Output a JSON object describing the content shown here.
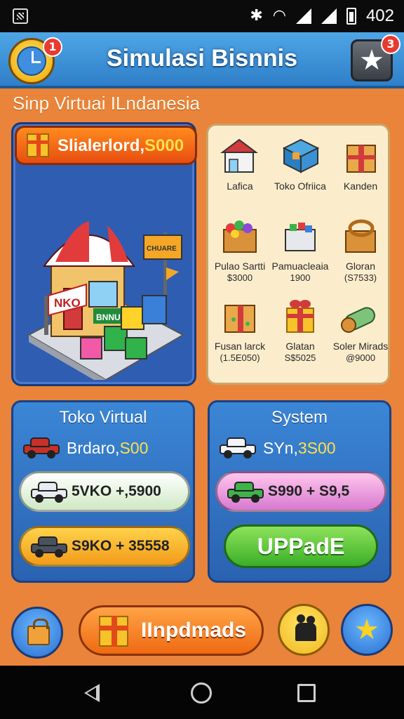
{
  "status_bar": {
    "time": "402"
  },
  "header": {
    "title": "Simulasi Bisnnis",
    "clock_badge": "1",
    "star_badge": "3"
  },
  "subtitle": "Sinp Virtuai ILndanesia",
  "reward": {
    "label": "Slialerlord,",
    "amount": "S000"
  },
  "shop_sign": {
    "left": "NKO",
    "right": "CHUARE",
    "store": "BNNUS"
  },
  "catalog": {
    "items": [
      {
        "label": "Lafica",
        "price": ""
      },
      {
        "label": "Toko Ofriica",
        "price": ""
      },
      {
        "label": "Kanden",
        "price": ""
      },
      {
        "label": "Pulao Sartti",
        "price": "$3000"
      },
      {
        "label": "Pamuacleaia",
        "price": "1900"
      },
      {
        "label": "Gloran",
        "price": "(S7533)"
      },
      {
        "label": "Fusan larck",
        "price": "(1.5E050)"
      },
      {
        "label": "Glatan",
        "price": "S$5025"
      },
      {
        "label": "Soler Mirads",
        "price": "@9000"
      }
    ]
  },
  "panels": {
    "left": {
      "title": "Toko Virtual",
      "car_label": "Brdaro,",
      "car_amount": "S00",
      "pill1": "5VKO +,5900",
      "pill2": "S9KO + 35558"
    },
    "right": {
      "title": "System",
      "car_label": "SYn,",
      "car_amount": "3S00",
      "pill1": "S990 + S9,5",
      "upgrade": "UPPadE"
    }
  },
  "bottom": {
    "updates_label": "IInpdmads"
  },
  "colors": {
    "background": "#e9843a",
    "header_blue": "#2f7fc8",
    "panel_blue": "#2a62b0",
    "accent_yellow": "#ffe04a",
    "upgrade_green": "#3cae28"
  },
  "icons": {
    "clock": "clock-icon",
    "star": "star-icon",
    "gift": "gift-icon",
    "bag": "shopping-bag-icon",
    "friends": "friends-icon"
  }
}
